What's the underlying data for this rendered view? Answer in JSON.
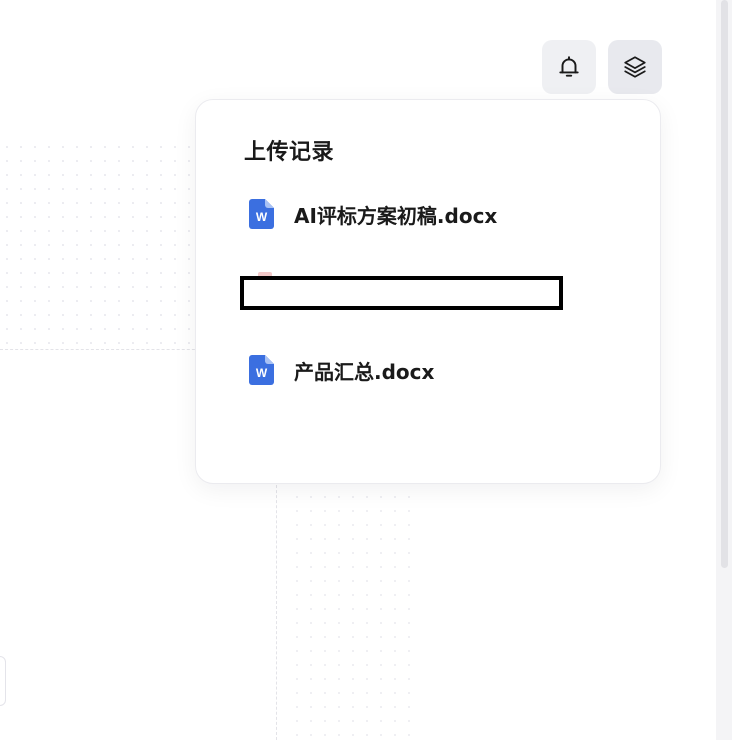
{
  "header": {
    "notifications_icon": "bell-icon",
    "uploads_icon": "layers-icon"
  },
  "upload_panel": {
    "title": "上传记录",
    "files": [
      {
        "name": "AI评标方案初稿.docx",
        "icon": "word-file-icon",
        "redacted": false
      },
      {
        "name": "",
        "icon": "file-icon",
        "redacted": true
      },
      {
        "name": "产品汇总.docx",
        "icon": "word-file-icon",
        "redacted": false
      }
    ]
  },
  "colors": {
    "word_icon": "#3b6fe0",
    "button_bg": "#eff0f3",
    "text": "#1a1a1a"
  }
}
